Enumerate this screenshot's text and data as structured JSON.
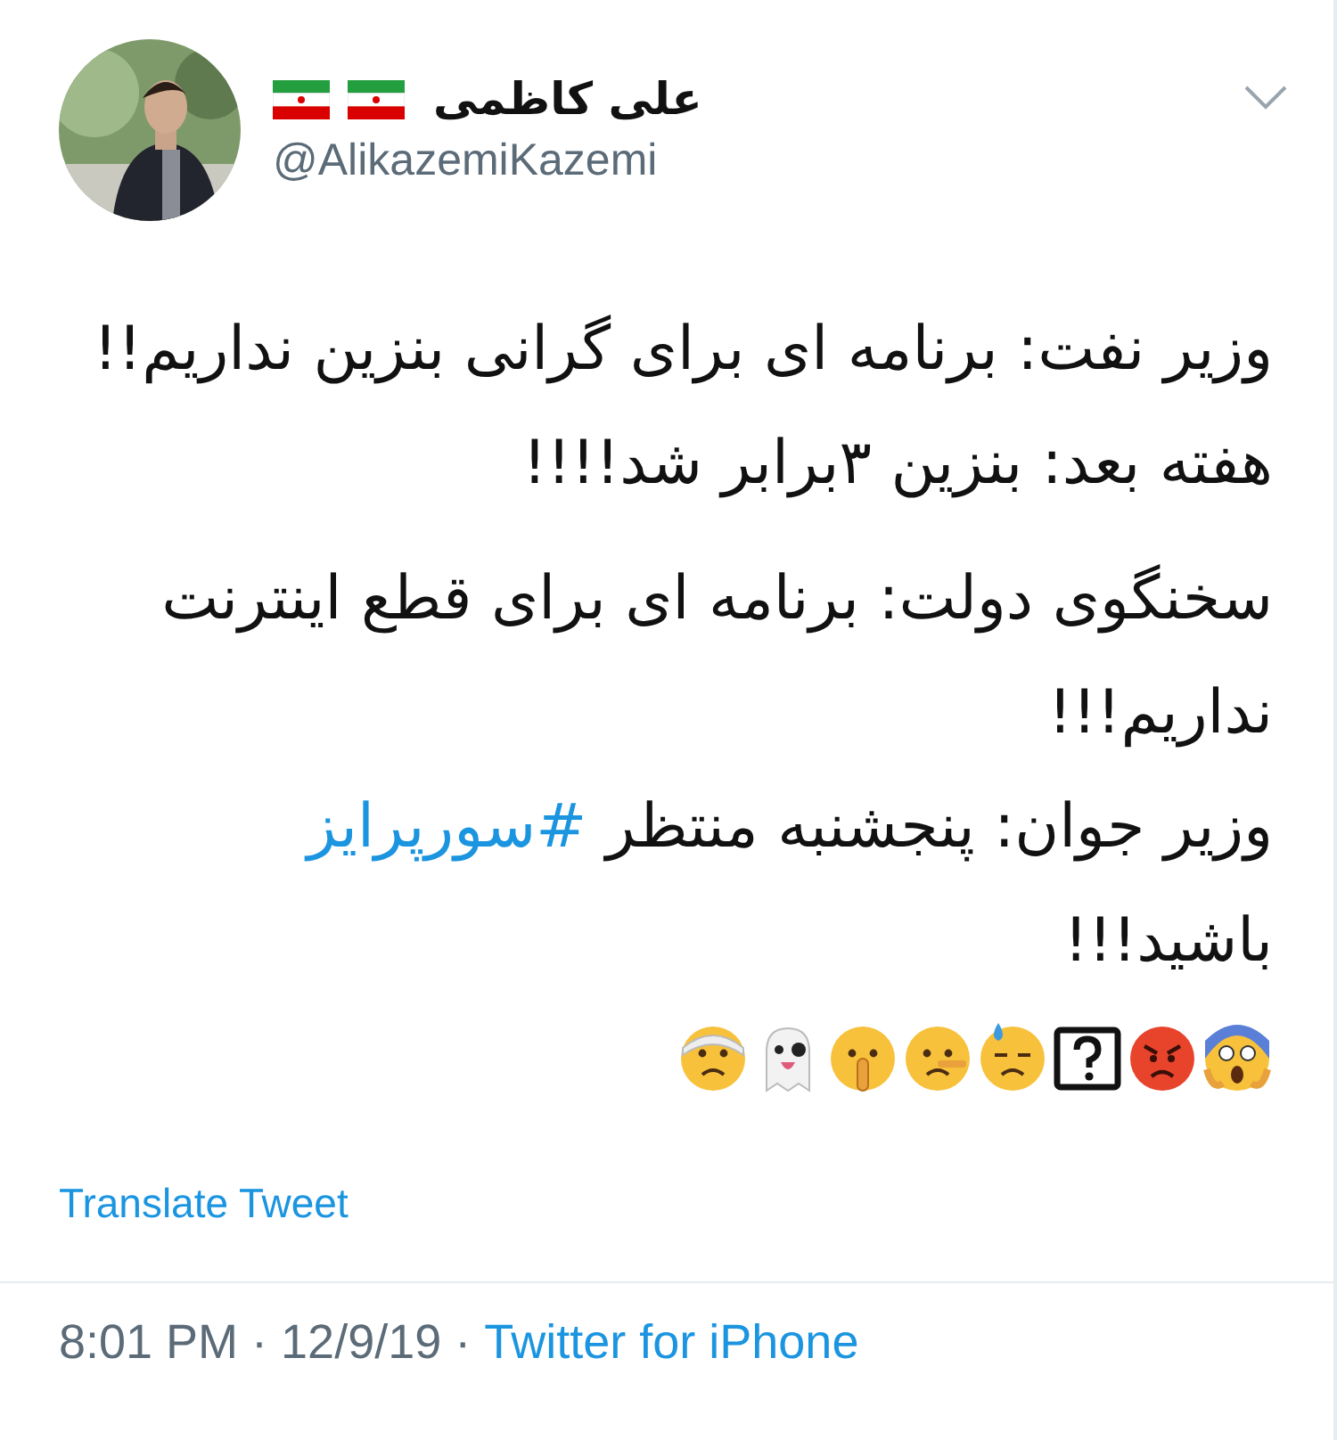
{
  "author": {
    "name": "علی کاظمی",
    "badges": [
      {
        "kind": "flag"
      },
      {
        "kind": "flag"
      }
    ],
    "handle": "@AlikazemiKazemi"
  },
  "tweet": [
    {
      "lines": [
        {
          "text": "وزیر نفت: برنامه ای برای گرانی بنزین نداریم!!"
        },
        {
          "text": "هفته بعد: بنزین ۳برابر شد!!!!"
        }
      ]
    },
    {
      "lines": [
        {
          "text": "سخنگوی دولت: برنامه ای برای قطع اینترنت"
        },
        {
          "text": "نداریم!!!"
        },
        {
          "text": "وزیر جوان: پنجشنبه منتظر ",
          "hashtag": "#سورپرایز"
        },
        {
          "text": "باشید!!!"
        }
      ]
    }
  ],
  "emojis": [
    {
      "kind": "bandage"
    },
    {
      "kind": "ghost"
    },
    {
      "kind": "shush"
    },
    {
      "kind": "lying"
    },
    {
      "kind": "sweat"
    },
    {
      "kind": "missing"
    },
    {
      "kind": "angry"
    },
    {
      "kind": "scream"
    }
  ],
  "translate": "Translate Tweet",
  "footer": {
    "meta": "8:01 PM · 12/9/19 · ",
    "source": "Twitter for iPhone"
  }
}
